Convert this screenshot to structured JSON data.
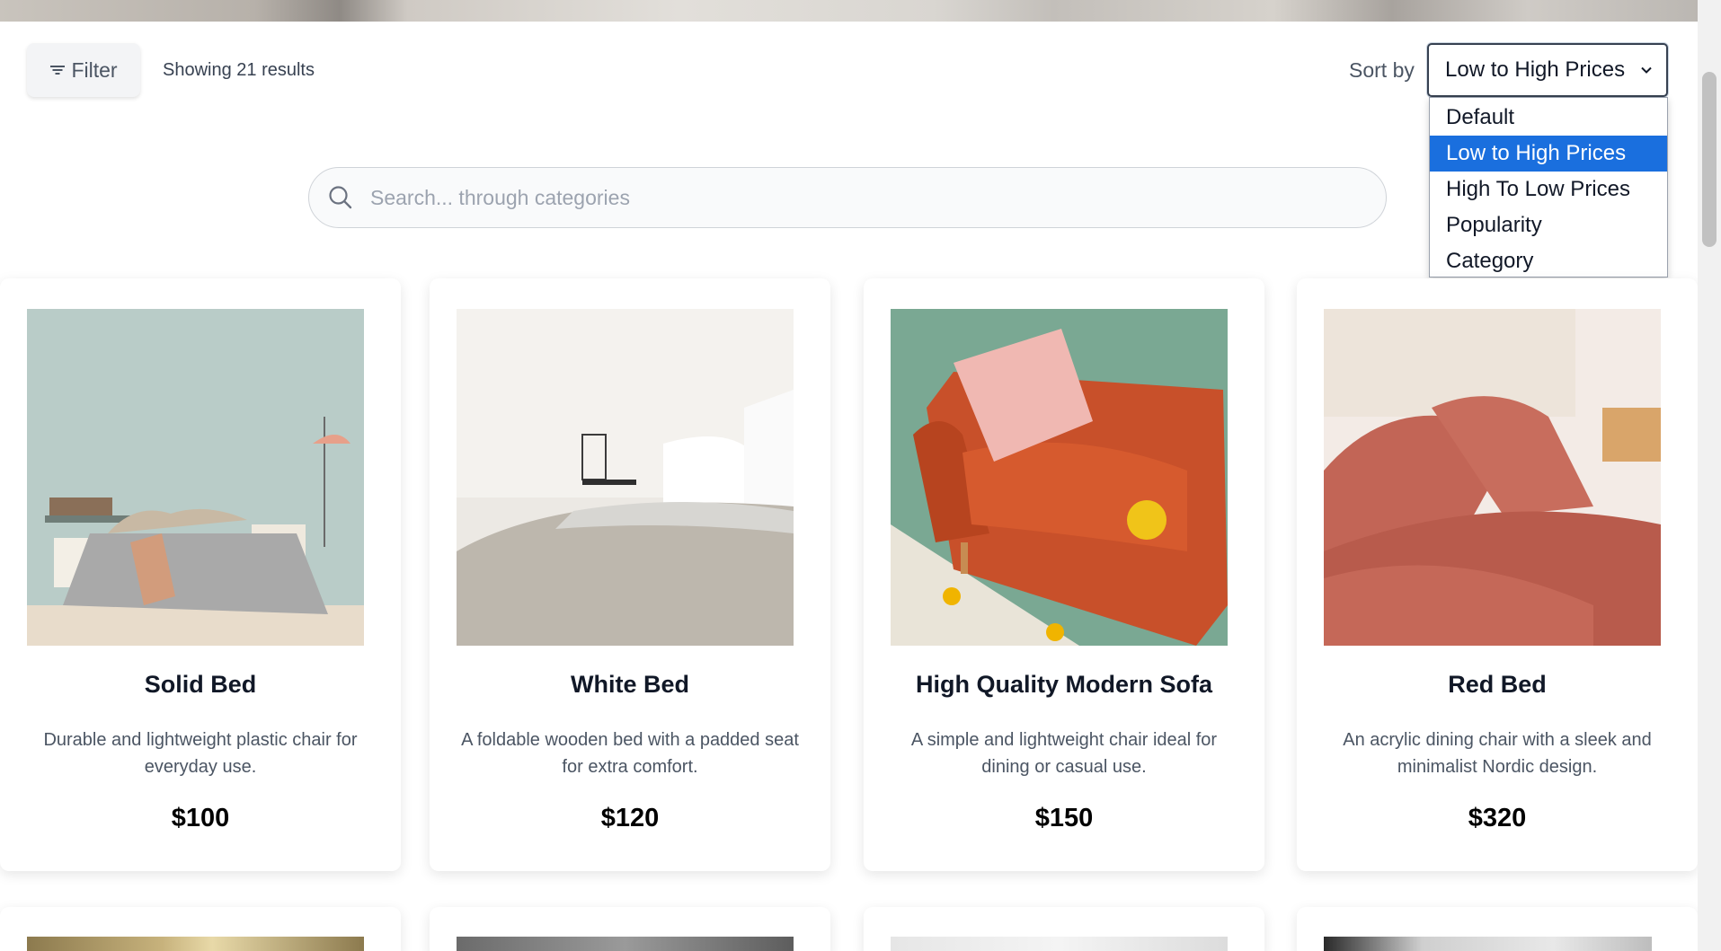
{
  "toolbar": {
    "filter_label": "Filter",
    "results_text": "Showing 21 results",
    "sort_label": "Sort by",
    "sort_selected": "Low to High Prices",
    "sort_options": [
      "Default",
      "Low to High Prices",
      "High To Low Prices",
      "Popularity",
      "Category"
    ]
  },
  "search": {
    "placeholder": "Search... through categories",
    "value": ""
  },
  "products": [
    {
      "title": "Solid Bed",
      "description": "Durable and lightweight plastic chair for everyday use.",
      "price": "$100",
      "image": "grey-bed-photo"
    },
    {
      "title": "White Bed",
      "description": "A foldable wooden bed with a padded seat for extra comfort.",
      "price": "$120",
      "image": "white-bed-photo"
    },
    {
      "title": "High Quality Modern Sofa",
      "description": "A simple and lightweight chair ideal for dining or casual use.",
      "price": "$150",
      "image": "orange-sofa-photo"
    },
    {
      "title": "Red Bed",
      "description": "An acrylic dining chair with a sleek and minimalist Nordic design.",
      "price": "$320",
      "image": "red-bed-photo"
    }
  ],
  "colors": {
    "accent_selected": "#1a6fde",
    "price_text": "#000000",
    "muted_text": "#4b5563"
  }
}
